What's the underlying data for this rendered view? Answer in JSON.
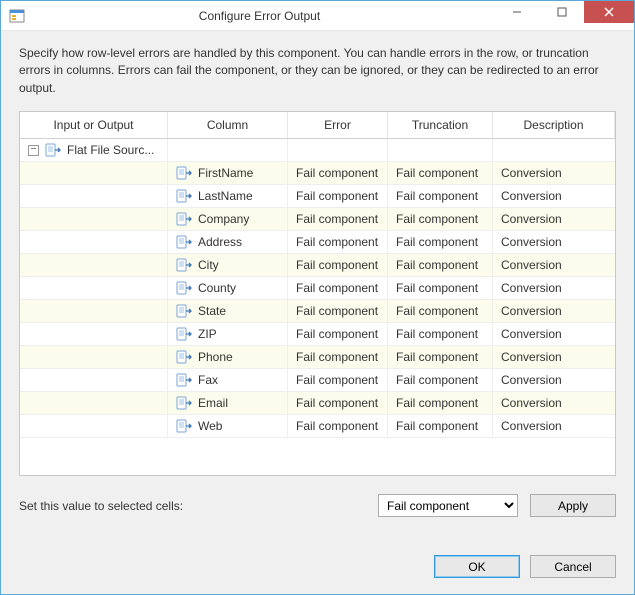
{
  "title": "Configure Error Output",
  "instructions": "Specify how row-level errors are handled by this component. You can handle errors in the row, or truncation errors in columns. Errors can fail the component, or they can be ignored, or they can be redirected to an error output.",
  "grid": {
    "headers": {
      "input_output": "Input or Output",
      "column": "Column",
      "error": "Error",
      "truncation": "Truncation",
      "description": "Description"
    },
    "tree_root": "Flat File Sourc...",
    "rows": [
      {
        "column": "FirstName",
        "error": "Fail component",
        "truncation": "Fail component",
        "description": "Conversion"
      },
      {
        "column": "LastName",
        "error": "Fail component",
        "truncation": "Fail component",
        "description": "Conversion"
      },
      {
        "column": "Company",
        "error": "Fail component",
        "truncation": "Fail component",
        "description": "Conversion"
      },
      {
        "column": "Address",
        "error": "Fail component",
        "truncation": "Fail component",
        "description": "Conversion"
      },
      {
        "column": "City",
        "error": "Fail component",
        "truncation": "Fail component",
        "description": "Conversion"
      },
      {
        "column": "County",
        "error": "Fail component",
        "truncation": "Fail component",
        "description": "Conversion"
      },
      {
        "column": "State",
        "error": "Fail component",
        "truncation": "Fail component",
        "description": "Conversion"
      },
      {
        "column": "ZIP",
        "error": "Fail component",
        "truncation": "Fail component",
        "description": "Conversion"
      },
      {
        "column": "Phone",
        "error": "Fail component",
        "truncation": "Fail component",
        "description": "Conversion"
      },
      {
        "column": "Fax",
        "error": "Fail component",
        "truncation": "Fail component",
        "description": "Conversion"
      },
      {
        "column": "Email",
        "error": "Fail component",
        "truncation": "Fail component",
        "description": "Conversion"
      },
      {
        "column": "Web",
        "error": "Fail component",
        "truncation": "Fail component",
        "description": "Conversion"
      }
    ]
  },
  "apply": {
    "label": "Set this value to selected cells:",
    "selected": "Fail component",
    "button": "Apply"
  },
  "footer": {
    "ok": "OK",
    "cancel": "Cancel"
  }
}
